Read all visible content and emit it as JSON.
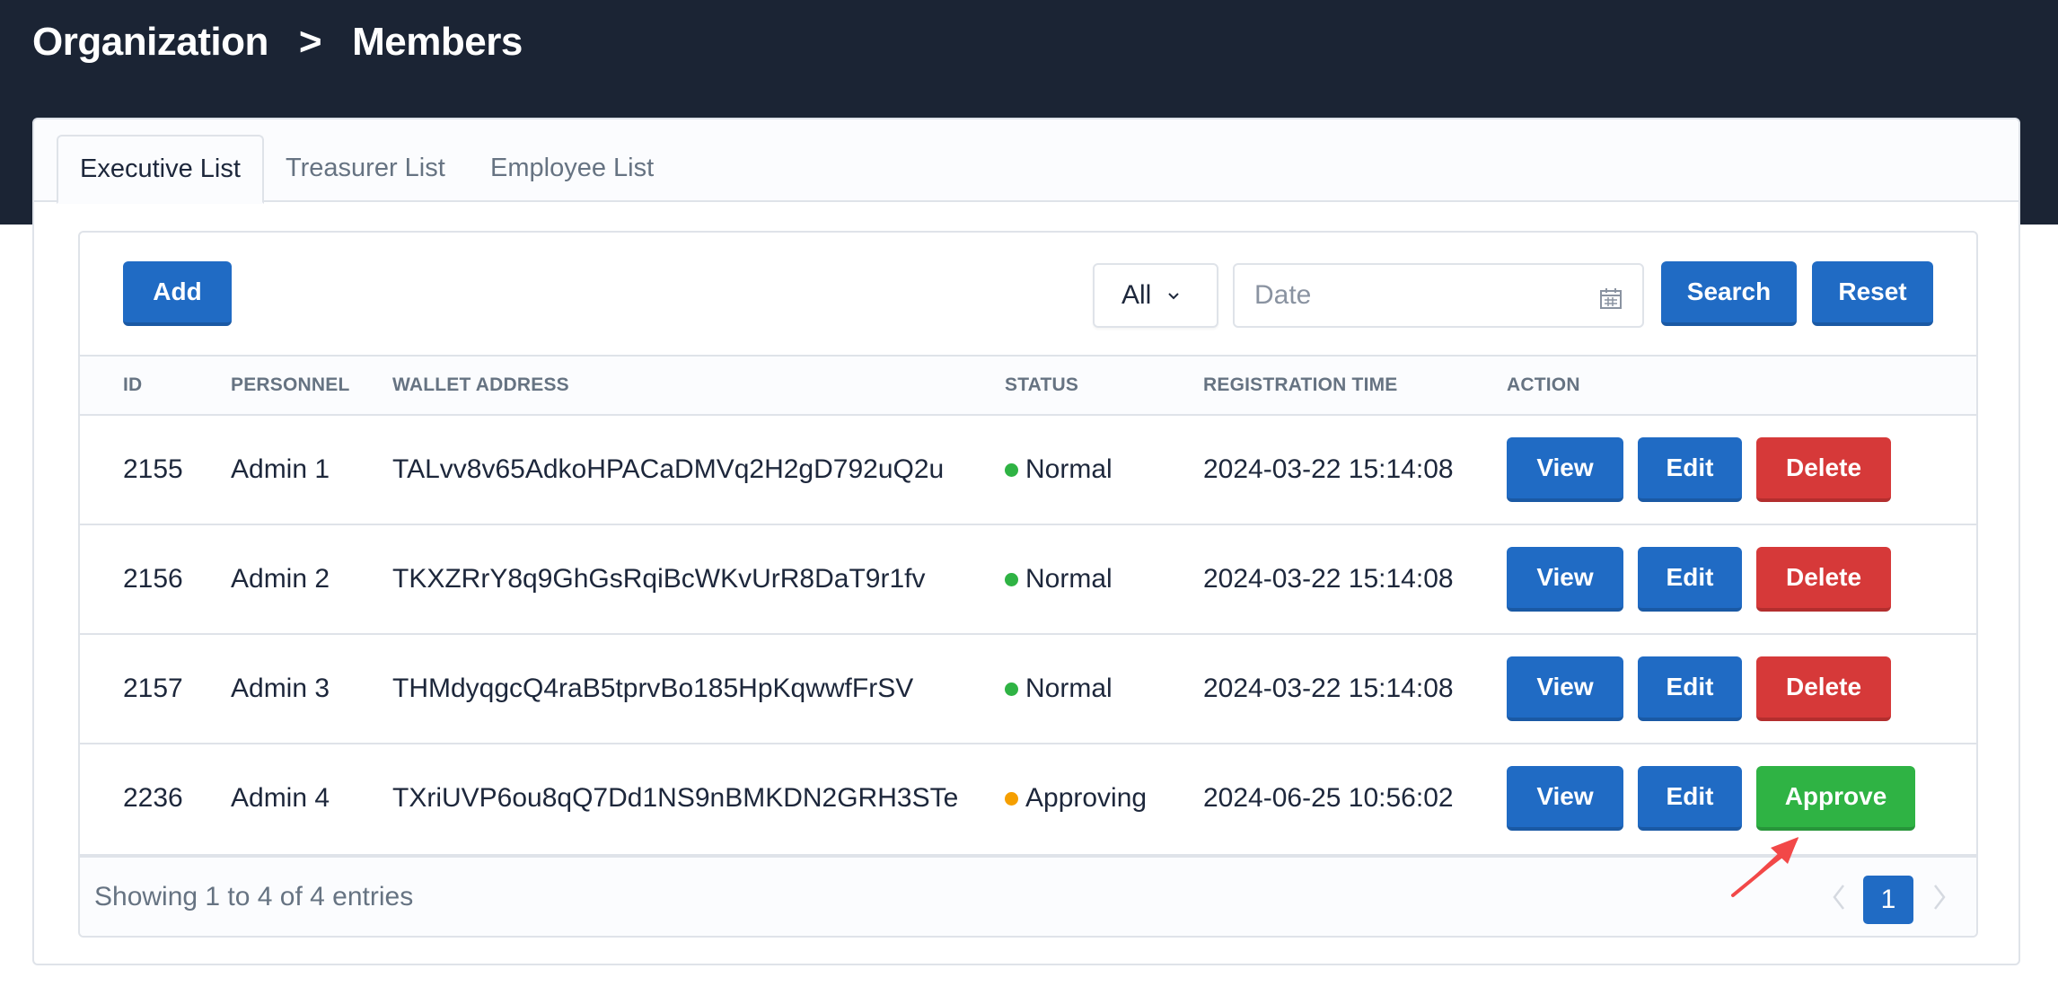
{
  "header": {
    "breadcrumb": [
      "Organization",
      "Members"
    ],
    "separator": ">"
  },
  "tabs": [
    {
      "label": "Executive List",
      "active": true
    },
    {
      "label": "Treasurer List",
      "active": false
    },
    {
      "label": "Employee List",
      "active": false
    }
  ],
  "toolbar": {
    "add_label": "Add",
    "status_filter": {
      "selected": "All",
      "icon": "chevron-down-icon"
    },
    "date_input": {
      "value": "",
      "placeholder": "Date",
      "icon": "calendar-icon"
    },
    "search_label": "Search",
    "reset_label": "Reset"
  },
  "table": {
    "columns": [
      "ID",
      "PERSONNEL",
      "WALLET ADDRESS",
      "STATUS",
      "REGISTRATION TIME",
      "ACTION"
    ],
    "rows": [
      {
        "id": "2155",
        "personnel": "Admin 1",
        "wallet": "TALvv8v65AdkoHPACaDMVq2H2gD792uQ2u",
        "status": "Normal",
        "status_color": "#2fb344",
        "time": "2024-03-22 15:14:08",
        "actions": [
          "View",
          "Edit",
          "Delete"
        ]
      },
      {
        "id": "2156",
        "personnel": "Admin 2",
        "wallet": "TKXZRrY8q9GhGsRqiBcWKvUrR8DaT9r1fv",
        "status": "Normal",
        "status_color": "#2fb344",
        "time": "2024-03-22 15:14:08",
        "actions": [
          "View",
          "Edit",
          "Delete"
        ]
      },
      {
        "id": "2157",
        "personnel": "Admin 3",
        "wallet": "THMdyqgcQ4raB5tprvBo185HpKqwwfFrSV",
        "status": "Normal",
        "status_color": "#2fb344",
        "time": "2024-03-22 15:14:08",
        "actions": [
          "View",
          "Edit",
          "Delete"
        ]
      },
      {
        "id": "2236",
        "personnel": "Admin 4",
        "wallet": "TXriUVP6ou8qQ7Dd1NS9nBMKDN2GRH3STe",
        "status": "Approving",
        "status_color": "#f59f00",
        "time": "2024-06-25 10:56:02",
        "actions": [
          "View",
          "Edit",
          "Approve"
        ]
      }
    ]
  },
  "footer": {
    "info": "Showing 1 to 4 of 4 entries",
    "pagination": {
      "current_page": "1",
      "prev_icon": "chevron-left-icon",
      "next_icon": "chevron-right-icon"
    }
  },
  "colors": {
    "header_bg": "#1b2434",
    "primary": "#206bc4",
    "danger": "#d63939",
    "success": "#2fb344",
    "warning": "#f59f00",
    "annotation_arrow": "#f24848"
  }
}
